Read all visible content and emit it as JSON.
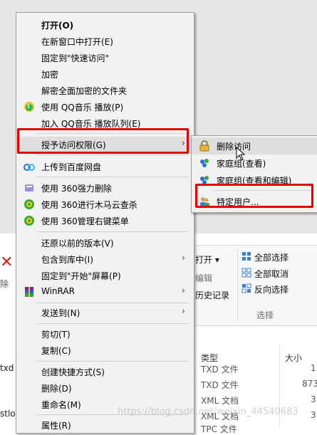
{
  "menu": {
    "items": [
      {
        "label": "打开(O)"
      },
      {
        "label": "在新窗口中打开(E)"
      },
      {
        "label": "固定到\"快速访问\""
      },
      {
        "label": "加密"
      },
      {
        "label": "解密全面加密的文件夹"
      },
      {
        "label": "使用 QQ音乐 播放(P)"
      },
      {
        "label": "加入 QQ音乐 播放队列(E)"
      },
      {
        "label": "授予访问权限(G)"
      },
      {
        "label": "上传到百度网盘"
      },
      {
        "label": "使用 360强力删除"
      },
      {
        "label": "使用 360进行木马云查杀"
      },
      {
        "label": "使用 360管理右键菜单"
      },
      {
        "label": "还原以前的版本(V)"
      },
      {
        "label": "包含到库中(I)"
      },
      {
        "label": "固定到\"开始\"屏幕(P)"
      },
      {
        "label": "WinRAR"
      },
      {
        "label": "发送到(N)"
      },
      {
        "label": "剪切(T)"
      },
      {
        "label": "复制(C)"
      },
      {
        "label": "创建快捷方式(S)"
      },
      {
        "label": "删除(D)"
      },
      {
        "label": "重命名(M)"
      },
      {
        "label": "属性(R)"
      }
    ],
    "arrow": "›"
  },
  "submenu": {
    "items": [
      {
        "label": "删除访问"
      },
      {
        "label": "家庭组(查看)"
      },
      {
        "label": "家庭组(查看和编辑)"
      },
      {
        "label": "特定用户..."
      }
    ]
  },
  "ribbon": {
    "open": "打开 ▾",
    "edit": "编辑",
    "history": "历史记录",
    "select_all": "全部选择",
    "select_none": "全部取消",
    "invert": "反向选择",
    "group_select": "选择"
  },
  "filelist": {
    "col_type": "类型",
    "col_size": "大小",
    "rows": [
      {
        "type": "TXD 文件",
        "size": "1"
      },
      {
        "type": "TXD 文件",
        "size": "873"
      },
      {
        "type": "XML 文档",
        "size": "3"
      },
      {
        "type": "XML 文档",
        "size": "3"
      },
      {
        "type": "TPC 文件",
        "size": ""
      }
    ]
  },
  "left_fragments": {
    "delete": "除",
    "txd": "txd",
    "stlog": "stlog"
  },
  "watermark": "https://blog.csdn.net/weixin_44540683",
  "colors": {
    "menu_bg": "#f2f2f2",
    "highlight": "#dedede",
    "red_annotation": "#e50000",
    "qq_green": "#2dbb4a",
    "shield_green": "#39a935",
    "homegroup_blue": "#2d6fd1"
  }
}
